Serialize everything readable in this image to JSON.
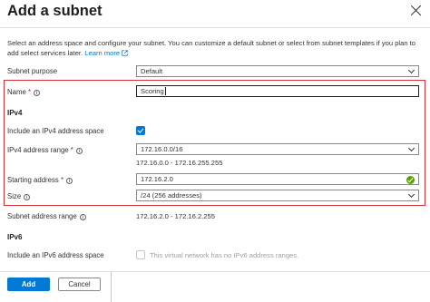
{
  "panel": {
    "title": "Add a subnet",
    "description": "Select an address space and configure your subnet. You can customize a default subnet or select from subnet templates if you plan to add select services later.",
    "learn_more": "Learn more"
  },
  "form": {
    "subnet_purpose": {
      "label": "Subnet purpose",
      "value": "Default"
    },
    "name": {
      "label": "Name",
      "required_mark": "*",
      "value": "Scoring"
    },
    "ipv4_section": "IPv4",
    "include_ipv4": {
      "label": "Include an IPv4 address space",
      "checked": true
    },
    "ipv4_range": {
      "label": "IPv4 address range",
      "required_mark": "*",
      "value": "172.16.0.0/16",
      "range_text": "172.16.0.0 - 172.16.255.255"
    },
    "starting_address": {
      "label": "Starting address",
      "required_mark": "*",
      "value": "172.16.2.0"
    },
    "size": {
      "label": "Size",
      "value": "/24 (256 addresses)"
    },
    "subnet_address_range": {
      "label": "Subnet address range",
      "value": "172.16.2.0 - 172.16.2.255"
    },
    "ipv6_section": "IPv6",
    "include_ipv6": {
      "label": "Include an IPv6 address space",
      "checked": false,
      "note": "This virtual network has no IPv6 address ranges."
    }
  },
  "footer": {
    "add_label": "Add",
    "cancel_label": "Cancel"
  },
  "colors": {
    "accent": "#0078d4",
    "highlight_border": "#d13438",
    "valid": "#57a300"
  },
  "icons": [
    "close-icon",
    "info-icon",
    "external-link-icon",
    "chevron-down-icon",
    "checkmark-icon",
    "valid-check-icon"
  ]
}
